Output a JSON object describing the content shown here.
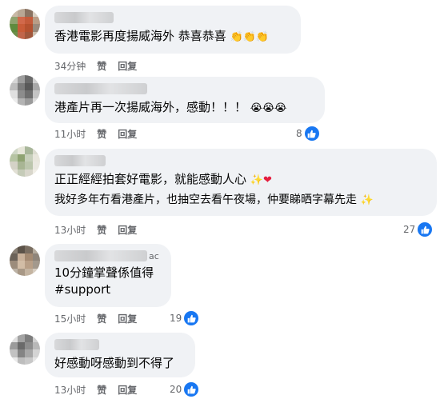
{
  "comments": [
    {
      "text_lines": [
        "香港電影再度揚威海外 恭喜恭喜"
      ],
      "emoji_after": "👏👏👏",
      "time": "34分钟",
      "like_label": "赞",
      "reply_label": "回复",
      "reactions": ""
    },
    {
      "text_lines": [
        "港產片再一次揚威海外，感動！！！"
      ],
      "emoji_after": "😭😭😭",
      "time": "11小时",
      "like_label": "赞",
      "reply_label": "回复",
      "reactions": "8"
    },
    {
      "text_lines": [
        "正正經經拍套好電影，就能感動人心",
        "我好多年冇看港產片，也抽空去看午夜場，仲要睇晒字幕先走"
      ],
      "emoji_line1": "✨❤",
      "emoji_line2": "✨",
      "time": "13小时",
      "like_label": "赞",
      "reply_label": "回复",
      "reactions": "27"
    },
    {
      "name_tail": "ac",
      "text_lines": [
        "10分鐘掌聲係值得",
        "#support"
      ],
      "time": "15小时",
      "like_label": "赞",
      "reply_label": "回复",
      "reactions": "19"
    },
    {
      "text_lines": [
        "好感動呀感動到不得了"
      ],
      "time": "13小时",
      "like_label": "赞",
      "reply_label": "回复",
      "reactions": "20"
    }
  ],
  "colors": {
    "bubble": "#f0f2f5",
    "meta_text": "#65676b",
    "like_blue": "#1877f2",
    "heart_red": "#e41e3f"
  },
  "icons": {
    "reaction": "like-thumb-icon"
  }
}
